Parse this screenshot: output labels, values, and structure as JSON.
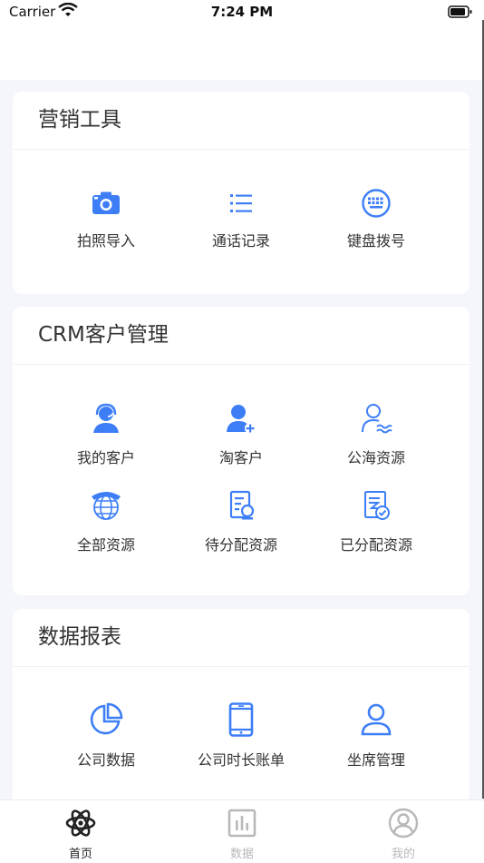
{
  "status_bar": {
    "carrier": "Carrier",
    "time": "7:24 PM"
  },
  "sections": [
    {
      "title": "营销工具",
      "items": [
        {
          "label": "拍照导入",
          "icon": "camera-icon"
        },
        {
          "label": "通话记录",
          "icon": "list-icon"
        },
        {
          "label": "键盘拨号",
          "icon": "keypad-icon"
        }
      ]
    },
    {
      "title": "CRM客户管理",
      "items": [
        {
          "label": "我的客户",
          "icon": "customer-service-icon"
        },
        {
          "label": "淘客户",
          "icon": "add-user-icon"
        },
        {
          "label": "公海资源",
          "icon": "sea-user-icon"
        },
        {
          "label": "全部资源",
          "icon": "globe-phone-icon"
        },
        {
          "label": "待分配资源",
          "icon": "pending-assign-icon"
        },
        {
          "label": "已分配资源",
          "icon": "assigned-icon"
        }
      ]
    },
    {
      "title": "数据报表",
      "items": [
        {
          "label": "公司数据",
          "icon": "pie-chart-icon"
        },
        {
          "label": "公司时长账单",
          "icon": "tablet-icon"
        },
        {
          "label": "坐席管理",
          "icon": "user-icon"
        }
      ]
    }
  ],
  "tabs": [
    {
      "label": "首页",
      "icon": "atom-icon",
      "active": true
    },
    {
      "label": "数据",
      "icon": "data-chart-icon",
      "active": false
    },
    {
      "label": "我的",
      "icon": "profile-icon",
      "active": false
    }
  ],
  "colors": {
    "accent": "#3d7ef7",
    "text": "#333333",
    "tab_inactive": "#b8b8b8"
  }
}
